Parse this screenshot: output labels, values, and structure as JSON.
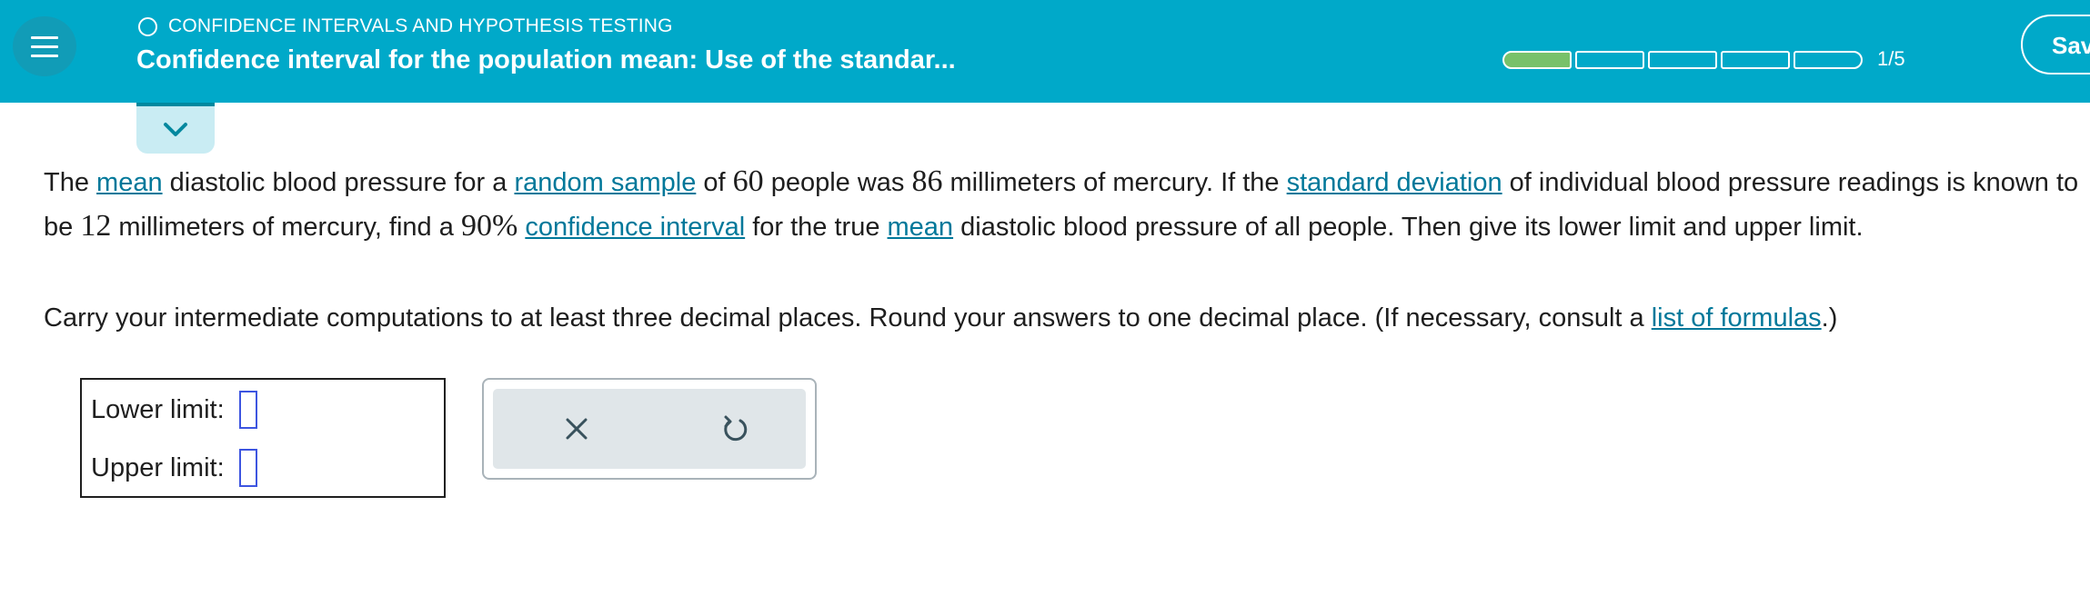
{
  "header": {
    "topic": "CONFIDENCE INTERVALS AND HYPOTHESIS TESTING",
    "title": "Confidence interval for the population mean: Use of the standar...",
    "progress": {
      "current": 1,
      "total": 5,
      "label": "1/5"
    },
    "save_label": "Save",
    "menu_icon": "hamburger-menu-icon",
    "collapse_icon": "chevron-down-icon"
  },
  "problem": {
    "p1": {
      "t1": "The ",
      "l1": "mean",
      "t2": " diastolic blood pressure for a ",
      "l2": "random sample",
      "t3": " of ",
      "m1": "60",
      "t4": " people was ",
      "m2": "86",
      "t5": " millimeters of mercury. If the ",
      "l3": "standard deviation",
      "t6": " of individual blood pressure readings is known to be ",
      "m3": "12",
      "t7": " millimeters of mercury, find a ",
      "m4": "90%",
      "t8": " ",
      "l4": "confidence interval",
      "t9": " for the true ",
      "l5": "mean",
      "t10": " diastolic blood pressure of all people. Then give its lower limit and upper limit."
    },
    "p2": {
      "t1": "Carry your intermediate computations to at least three decimal places. Round your answers to one decimal place. (If necessary, consult a ",
      "l1": "list of formulas",
      "t2": ".)"
    }
  },
  "answers": {
    "lower_label": "Lower limit:",
    "upper_label": "Upper limit:",
    "lower_value": "",
    "upper_value": ""
  },
  "tools": {
    "clear_icon": "x-icon",
    "undo_icon": "undo-icon"
  },
  "colors": {
    "header_bg": "#00a9c9",
    "progress_fill": "#78c16a",
    "link": "#00789a",
    "input_border": "#3d55e0"
  }
}
